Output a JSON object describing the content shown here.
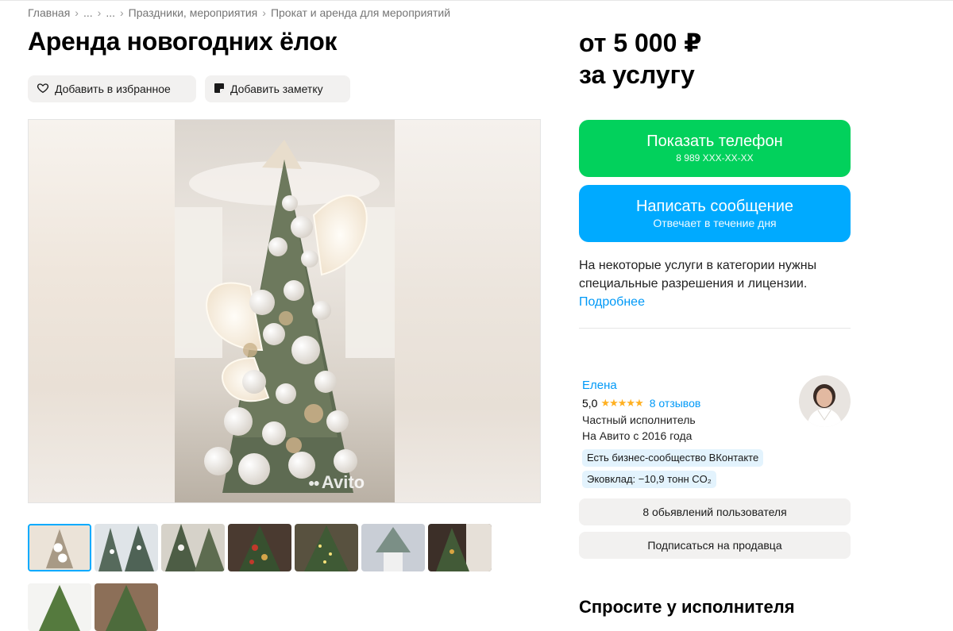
{
  "breadcrumb": [
    "Главная",
    "...",
    "...",
    "Праздники, мероприятия",
    "Прокат и аренда для мероприятий"
  ],
  "breadcrumb_sep": "›",
  "title": "Аренда новогодних ёлок",
  "actions": {
    "favorite_label": "Добавить в избранное",
    "note_label": "Добавить заметку"
  },
  "gallery": {
    "watermark": "Avito",
    "thumbnail_count": 10,
    "active_index": 0
  },
  "price": {
    "line1": "от 5 000 ₽",
    "line2": "за услугу"
  },
  "contact": {
    "phone_label": "Показать телефон",
    "phone_value": "8 989 XXX-XX-XX",
    "message_label": "Написать сообщение",
    "message_sub": "Отвечает в течение дня"
  },
  "license": {
    "text": "На некоторые услуги в категории нужны специальные разрешения и лицензии.",
    "link": "Подробнее"
  },
  "seller": {
    "name": "Елена",
    "rating": "5,0",
    "stars": "★★★★★",
    "reviews": "8 отзывов",
    "type": "Частный исполнитель",
    "since": "На Авито с 2016 года",
    "badge_vk": "Есть бизнес-сообщество ВКонтакте",
    "badge_eco": "Эковклад: −10,9 тонн CO₂",
    "ads_button": "8 обьявлений пользователя",
    "subscribe_button": "Подписаться на продавца"
  },
  "ask_title": "Спросите у исполнителя",
  "colors": {
    "green": "#02d15c",
    "blue": "#00aaff",
    "link": "#0099f7",
    "star": "#ffb021"
  }
}
